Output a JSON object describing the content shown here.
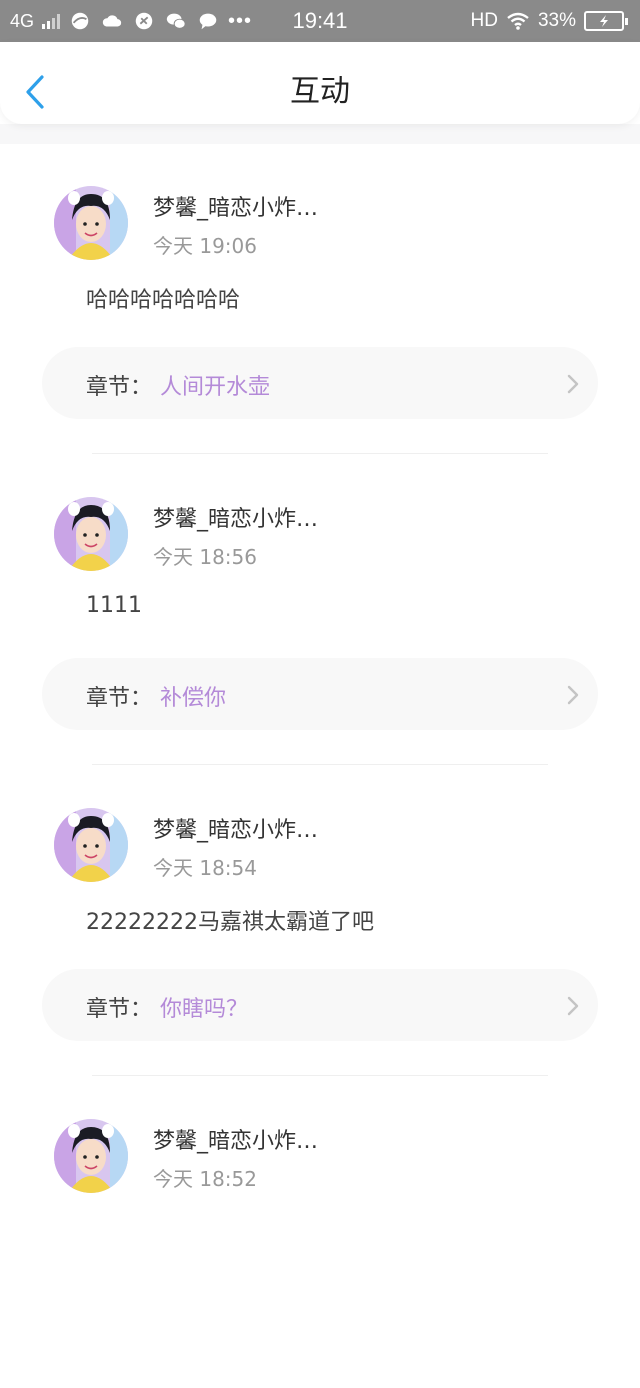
{
  "status_bar": {
    "network": "4G",
    "time": "19:41",
    "hd": "HD",
    "battery": "33%"
  },
  "header": {
    "title": "互动"
  },
  "comments": [
    {
      "username": "梦馨_暗恋小炸…",
      "time": "今天 19:06",
      "content": "哈哈哈哈哈哈哈",
      "chapter_label": "章节：",
      "chapter_name": "人间开水壶"
    },
    {
      "username": "梦馨_暗恋小炸…",
      "time": "今天 18:56",
      "content": "1111",
      "chapter_label": "章节：",
      "chapter_name": "补偿你"
    },
    {
      "username": "梦馨_暗恋小炸…",
      "time": "今天 18:54",
      "content": "22222222马嘉祺太霸道了吧",
      "chapter_label": "章节：",
      "chapter_name": "你瞎吗？"
    },
    {
      "username": "梦馨_暗恋小炸…",
      "time": "今天 18:52",
      "content": "",
      "chapter_label": "",
      "chapter_name": ""
    }
  ],
  "colors": {
    "accent": "#2ea0ea",
    "chapter_name": "#b48ad8",
    "status_bar": "#8a8a8a"
  },
  "icons": [
    "back-arrow-icon",
    "chevron-right-icon",
    "wifi-icon",
    "battery-icon",
    "signal-icon"
  ]
}
